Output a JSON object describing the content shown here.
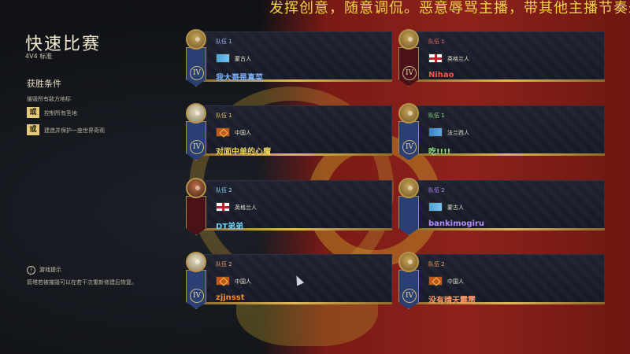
{
  "marquee_text": "发挥创意，随意调侃。恶意辱骂主播，带其他主播节奏永封",
  "header": {
    "title": "快速比赛",
    "mode": "4V4 标准"
  },
  "victory": {
    "title": "获胜条件",
    "main_condition": "摧毁所有敌方地标",
    "or_label": "或",
    "conditions": [
      "控制所有圣地",
      "建造并保护一座世界奇观"
    ]
  },
  "tip": {
    "title": "游戏提示",
    "text": "箭塔若被摧毁可以在若干次重新修建后恢复。"
  },
  "colors": {
    "gold": "#e0b85a",
    "team1": "#9aa1ff"
  },
  "players": [
    {
      "team": "队伍 1",
      "team_color": "#a7b4ff",
      "flag": "mongol-flag-icon",
      "civ": "蒙古人",
      "name": "我大哥是真菜",
      "name_color": "#7fb1ff",
      "rank": "IV",
      "avatar": "gold"
    },
    {
      "team": "队伍 1",
      "team_color": "#f06a5a",
      "flag": "english-flag-icon",
      "civ": "英格兰人",
      "name": "Nihao",
      "name_color": "#ef5b4b",
      "rank": "IV",
      "avatar": "gold"
    },
    {
      "team": "队伍 1",
      "team_color": "#e7c95a",
      "flag": "chinese-flag-icon",
      "civ": "中国人",
      "name": "对面中单的心魔",
      "name_color": "#f0d35a",
      "rank": "IV",
      "avatar": "pale"
    },
    {
      "team": "队伍 1",
      "team_color": "#8fe07a",
      "flag": "french-flag-icon",
      "civ": "法兰西人",
      "name": "吃!!!!",
      "name_color": "#8fe07a",
      "rank": "IV",
      "avatar": "gold"
    },
    {
      "team": "队伍 2",
      "team_color": "#8ad7f0",
      "flag": "english-flag-icon",
      "civ": "英格兰人",
      "name": "DT弟弟",
      "name_color": "#6fd0f5",
      "rank": "",
      "avatar": "portrait"
    },
    {
      "team": "队伍 2",
      "team_color": "#b08cff",
      "flag": "mongol-flag-icon",
      "civ": "蒙古人",
      "name": "bankimogiru",
      "name_color": "#b58cff",
      "rank": "",
      "avatar": "gold"
    },
    {
      "team": "队伍 2",
      "team_color": "#f0a05a",
      "flag": "chinese-flag-icon",
      "civ": "中国人",
      "name": "zjjnsst",
      "name_color": "#f08a3c",
      "rank": "IV",
      "avatar": "pale"
    },
    {
      "team": "队伍 2",
      "team_color": "#f0a05a",
      "flag": "chinese-flag-icon",
      "civ": "中国人",
      "name": "没有晴天霹雳",
      "name_color": "#ff9b6a",
      "rank": "IV",
      "avatar": "gold"
    }
  ]
}
